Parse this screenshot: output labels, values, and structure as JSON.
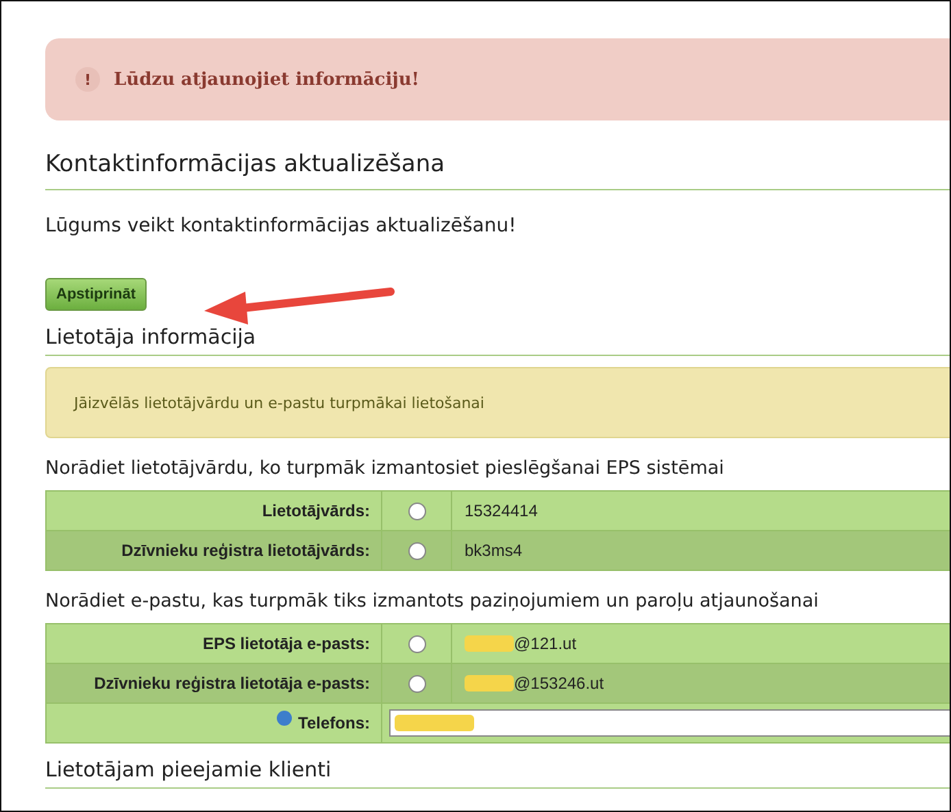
{
  "alert": {
    "icon": "!",
    "text": "Lūdzu atjaunojiet informāciju!"
  },
  "title": "Kontaktinformācijas aktualizēšana",
  "intro": "Lūgums veikt kontaktinformācijas aktualizēšanu!",
  "confirm_button": "Apstiprināt",
  "annotation_arrow": true,
  "user_section": {
    "heading": "Lietotāja informācija",
    "notice": "Jāizvēlās lietotājvārdu un e-pastu turpmākai lietošanai"
  },
  "username_group": {
    "prompt": "Norādiet lietotājvārdu, ko turpmāk izmantosiet pieslēgšanai EPS sistēmai",
    "rows": [
      {
        "label": "Lietotājvārds:",
        "selected": false,
        "value": "15324414",
        "redacted": false
      },
      {
        "label": "Dzīvnieku reģistra lietotājvārds:",
        "selected": false,
        "value": "bk3ms4",
        "redacted": false
      }
    ]
  },
  "email_group": {
    "prompt": "Norādiet e-pastu, kas turpmāk tiks izmantots paziņojumiem un paroļu atjaunošanai",
    "rows": [
      {
        "label": "EPS lietotāja e-pasts:",
        "selected": false,
        "value": "@121.ut",
        "redacted": true
      },
      {
        "label": "Dzīvnieku reģistra lietotāja e-pasts:",
        "selected": false,
        "value": "@153246.ut",
        "redacted": true
      }
    ]
  },
  "phone": {
    "label": "Telefons:",
    "redacted": true
  },
  "clients_heading": "Lietotājam pieejamie klienti"
}
